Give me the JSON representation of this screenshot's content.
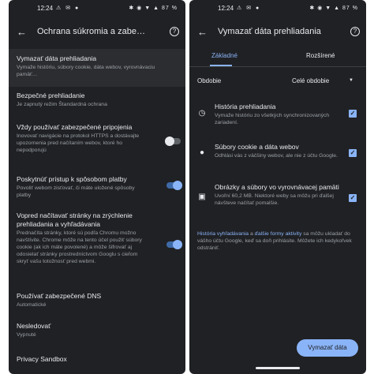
{
  "left": {
    "status": {
      "time": "12:24",
      "left_icons": "⚠ ✉ ●",
      "right_icons": "✱ ◉ ▼ ▲ 87 %"
    },
    "title": "Ochrana súkromia a zabe…",
    "items": [
      {
        "title": "Vymazať dáta prehliadania",
        "subtitle": "Vymaže históriu, súbory cookie, dáta webov, vyrovnávaciu pamäť…"
      },
      {
        "title": "Bezpečné prehliadanie",
        "subtitle": "Je zapnutý režim Štandardná ochrana"
      },
      {
        "title": "Vždy používať zabezpečené pripojenia",
        "subtitle": "Inovovať navigácie na protokol HTTPS a dostávajte upozornenia pred načítaním webov, ktoré ho nepodporujú",
        "toggle": "off"
      },
      {
        "title": "Poskytnúť prístup k spôsobom platby",
        "subtitle": "Povoliť webom zisťovať, či máte uložené spôsoby platby",
        "toggle": "on"
      },
      {
        "title": "Vopred načítavať stránky na zrýchlenie prehliadania a vyhľadávania",
        "subtitle": "Prednačíta stránky, ktoré sú podľa Chromu možno navštívite. Chrome môže na tento účel použiť súbory cookie (ak ich máte povolené) a môže šifrovať aj odosielať stránky prostredníctvom Googlu s cieľom skryť vašu totožnosť pred webmi.",
        "toggle": "on"
      },
      {
        "title": "Používať zabezpečené DNS",
        "subtitle": "Automatické"
      },
      {
        "title": "Nesledovať",
        "subtitle": "Vypnuté"
      },
      {
        "title": "Privacy Sandbox",
        "subtitle": ""
      }
    ]
  },
  "right": {
    "status": {
      "time": "12:24",
      "left_icons": "⚠ ✉ ●",
      "right_icons": "✱ ◉ ▼ ▲ 87 %"
    },
    "title": "Vymazať dáta prehliadania",
    "tabs": [
      "Základné",
      "Rozšírené"
    ],
    "period_label": "Obdobie",
    "period_value": "Celé obdobie",
    "items": [
      {
        "title": "História prehliadania",
        "subtitle": "Vymaže históriu zo všetkých synchronizovaných zariadení."
      },
      {
        "title": "Súbory cookie a dáta webov",
        "subtitle": "Odhlási vás z väčšiny webov, ale nie z účtu Google."
      },
      {
        "title": "Obrázky a súbory vo vyrovnávacej pamäti",
        "subtitle": "Uvoľní 60,2 MB. Niektoré weby sa môžu pri ďalšej návšteve načítať pomalšie."
      }
    ],
    "footer": {
      "link1": "História vyhľadávania",
      "mid1": " a ",
      "link2": "ďalšie formy aktivity",
      "rest": " sa môžu ukladať do vášho účtu Google, keď sa doň prihlásite. Môžete ich kedykoľvek odstrániť."
    },
    "clear_button": "Vymazať dáta"
  }
}
